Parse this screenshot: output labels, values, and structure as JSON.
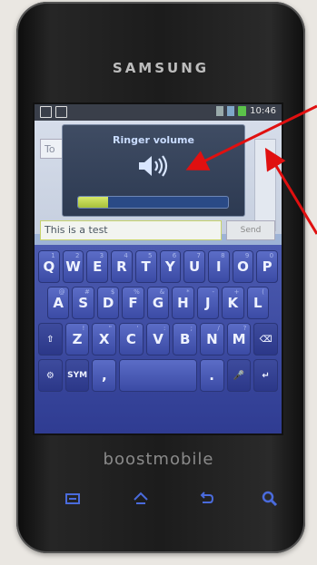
{
  "device": {
    "brand": "SAMSUNG",
    "carrier_logo": "boostmobile"
  },
  "statusbar": {
    "time": "10:46",
    "icons": [
      "notification-icon",
      "email-icon",
      "signal-icon",
      "wifi-icon",
      "battery-icon"
    ]
  },
  "messaging": {
    "to_placeholder": "To",
    "compose_text": "This is a test",
    "send_label": "Send"
  },
  "volume_dialog": {
    "title": "Ringer volume",
    "icon": "speaker-icon",
    "level": 0.2
  },
  "keyboard": {
    "row1": [
      {
        "key": "Q",
        "hint": "1"
      },
      {
        "key": "W",
        "hint": "2"
      },
      {
        "key": "E",
        "hint": "3"
      },
      {
        "key": "R",
        "hint": "4"
      },
      {
        "key": "T",
        "hint": "5"
      },
      {
        "key": "Y",
        "hint": "6"
      },
      {
        "key": "U",
        "hint": "7"
      },
      {
        "key": "I",
        "hint": "8"
      },
      {
        "key": "O",
        "hint": "9"
      },
      {
        "key": "P",
        "hint": "0"
      }
    ],
    "row2": [
      {
        "key": "A",
        "hint": "@"
      },
      {
        "key": "S",
        "hint": "#"
      },
      {
        "key": "D",
        "hint": "$"
      },
      {
        "key": "F",
        "hint": "%"
      },
      {
        "key": "G",
        "hint": "&"
      },
      {
        "key": "H",
        "hint": "*"
      },
      {
        "key": "J",
        "hint": "-"
      },
      {
        "key": "K",
        "hint": "+"
      },
      {
        "key": "L",
        "hint": "("
      }
    ],
    "row3": [
      {
        "key": "Z",
        "hint": "!"
      },
      {
        "key": "X",
        "hint": "\""
      },
      {
        "key": "C",
        "hint": "'"
      },
      {
        "key": "V",
        "hint": ":"
      },
      {
        "key": "B",
        "hint": ";"
      },
      {
        "key": "N",
        "hint": "/"
      },
      {
        "key": "M",
        "hint": "?"
      }
    ],
    "sym_label": "SYM",
    "shift_symbol": "⇧",
    "backspace_symbol": "⌫",
    "enter_symbol": "↵",
    "mic_symbol": "🎤",
    "comma": ",",
    "period": ".",
    "settings_symbol": "⚙"
  },
  "colors": {
    "volume_fill": "#b9d34c",
    "arrow": "#e01010",
    "nav_icons": "#4a6bdc"
  }
}
